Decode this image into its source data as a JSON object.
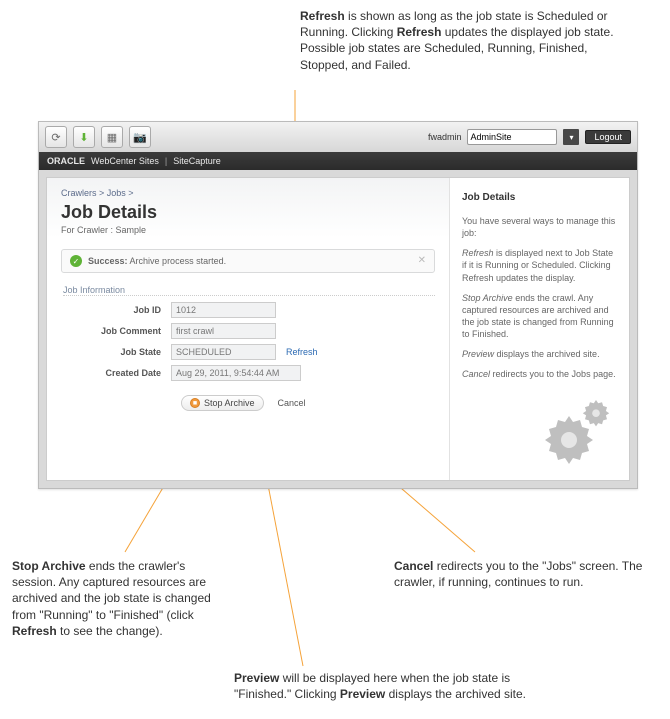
{
  "callouts": {
    "refresh": "Refresh is shown as long as the job state is Scheduled or Running. Clicking Refresh updates the displayed job state. Possible job states are Scheduled, Running, Finished, Stopped, and Failed.",
    "stop": "Stop Archive ends the crawler's session. Any captured resources are archived and the job state is changed from \"Running\" to \"Finished\" (click Refresh to see the change).",
    "cancel": "Cancel redirects you to the \"Jobs\" screen. The crawler, if running, continues to run.",
    "preview": "Preview will be displayed here when the job state is \"Finished.\" Clicking Preview displays the archived site."
  },
  "toolbar": {
    "user_label": "fwadmin",
    "site_value": "AdminSite",
    "logout": "Logout"
  },
  "darkbar": {
    "brand": "ORACLE",
    "product": "WebCenter Sites",
    "app": "SiteCapture"
  },
  "breadcrumb": "Crawlers > Jobs >",
  "page_title": "Job Details",
  "subtitle": "For Crawler : Sample",
  "flash": {
    "label_bold": "Success:",
    "label_rest": "Archive process started."
  },
  "section_header": "Job Information",
  "fields": {
    "job_id_label": "Job ID",
    "job_id_value": "1012",
    "comment_label": "Job Comment",
    "comment_value": "first crawl",
    "state_label": "Job State",
    "state_value": "SCHEDULED",
    "refresh_label": "Refresh",
    "created_label": "Created Date",
    "created_value": "Aug 29, 2011, 9:54:44 AM"
  },
  "actions": {
    "stop_archive": "Stop Archive",
    "cancel": "Cancel"
  },
  "sidebar": {
    "title": "Job Details",
    "intro": "You have several ways to manage this job:",
    "p1_i": "Refresh",
    "p1_rest": " is displayed next to Job State if it is Running or Scheduled. Clicking Refresh updates the display.",
    "p2_i": "Stop Archive",
    "p2_rest": " ends the crawl. Any captured resources are archived and the job state is changed from Running to Finished.",
    "p3_i": "Preview",
    "p3_rest": " displays the archived site.",
    "p4_i": "Cancel",
    "p4_rest": " redirects you to the Jobs page."
  }
}
